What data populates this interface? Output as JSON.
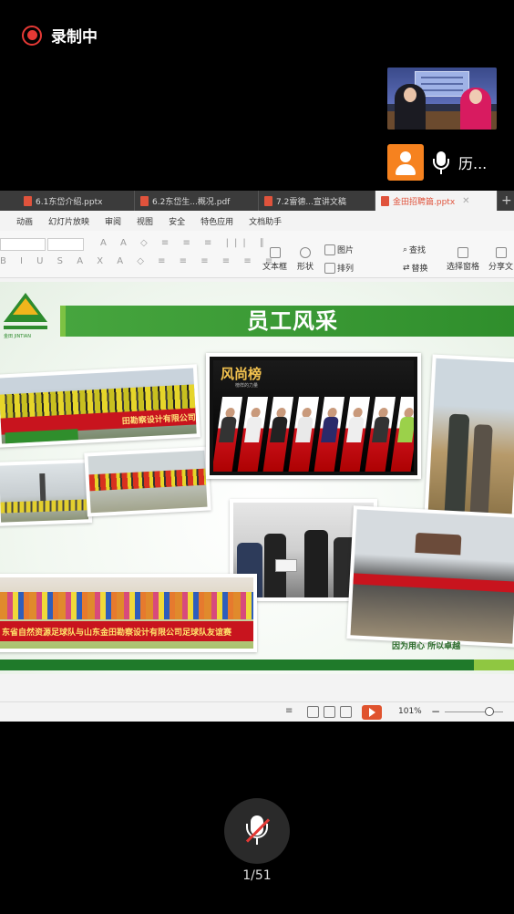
{
  "recording": {
    "label": "录制中"
  },
  "participant": {
    "name": "历..."
  },
  "tabs": [
    {
      "label": "6.1东岱介绍.pptx",
      "color": "#e0533c",
      "active": false
    },
    {
      "label": "6.2东岱生...概况.pdf",
      "color": "#e0533c",
      "active": false
    },
    {
      "label": "7.2雷德...宣讲文稿",
      "color": "#e0533c",
      "active": false
    },
    {
      "label": "金田招聘篇.pptx",
      "color": "#e0533c",
      "active": true
    }
  ],
  "menu": [
    "动画",
    "幻灯片放映",
    "审阅",
    "视图",
    "安全",
    "特色应用",
    "文档助手"
  ],
  "toolbar": {
    "textbox": "文本框",
    "shape": "形状",
    "picture": "图片",
    "arrange": "排列",
    "find": "查找",
    "replace": "替换",
    "select_pane": "选择窗格",
    "share": "分享文"
  },
  "slide": {
    "title": "员工风采",
    "logo_text": "金田  JINTIAN",
    "board_title": "风尚榜",
    "board_subtitle": "榜样的力量",
    "banner_top": "田勘察设计有限公司",
    "banner_bottom": "东省自然资源足球队与山东金田勘察设计有限公司足球队友谊赛",
    "banner_right": "",
    "bottom_caption": "因为用心 所以卓越"
  },
  "statusbar": {
    "zoom": "101%"
  },
  "pager": {
    "text": "1/51"
  },
  "colors": {
    "accent": "#2f8e2c",
    "record": "#e53935",
    "avatar": "#f6821f"
  }
}
